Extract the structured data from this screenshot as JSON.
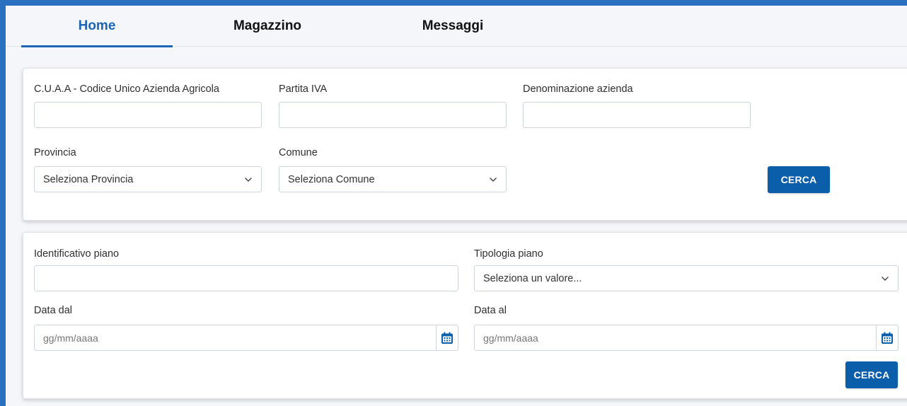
{
  "tabs": [
    {
      "label": "Home",
      "active": true
    },
    {
      "label": "Magazzino",
      "active": false
    },
    {
      "label": "Messaggi",
      "active": false
    }
  ],
  "search_company": {
    "cuaa_label": "C.U.A.A - Codice Unico Azienda Agricola",
    "cuaa_value": "",
    "piva_label": "Partita IVA",
    "piva_value": "",
    "denominazione_label": "Denominazione azienda",
    "denominazione_value": "",
    "provincia_label": "Provincia",
    "provincia_selected": "Seleziona Provincia",
    "comune_label": "Comune",
    "comune_selected": "Seleziona Comune",
    "search_button": "CERCA"
  },
  "search_plan": {
    "identificativo_label": "Identificativo piano",
    "identificativo_value": "",
    "tipologia_label": "Tipologia piano",
    "tipologia_selected": "Seleziona un valore...",
    "data_dal_label": "Data dal",
    "data_dal_placeholder": "gg/mm/aaaa",
    "data_al_label": "Data al",
    "data_al_placeholder": "gg/mm/aaaa",
    "search_button": "CERCA"
  },
  "icons": {
    "select_arrow": "chevron-down-icon",
    "date_picker": "calendar-icon"
  },
  "colors": {
    "primary": "#0b5eaa",
    "active_tab": "#1c66b5",
    "frame": "#2a6fc0"
  }
}
